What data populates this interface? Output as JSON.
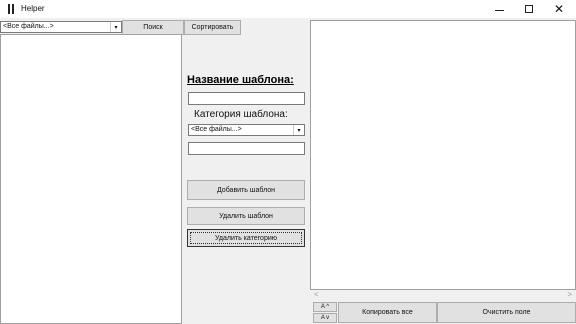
{
  "window": {
    "title": "Helper",
    "minimize_icon": "minimize-icon",
    "maximize_icon": "maximize-icon",
    "close_icon": "close-icon",
    "close_glyph": "✕"
  },
  "left": {
    "filter_combo_value": "<Все файлы...>",
    "combo_arrow": "▾",
    "search_label": "Поиск",
    "sort_label": "Сортировать"
  },
  "form": {
    "template_name_heading": "Название шаблона:",
    "template_category_label": "Категория шаблона:",
    "category_combo_value": "<Все файлы...>",
    "add_button": "Добавить шаблон",
    "delete_button": "Удалить шаблон",
    "delete_category_button": "Удалить категорию"
  },
  "right": {
    "scroll_left": "<",
    "scroll_right": ">",
    "font_up": "A ^",
    "font_down": "A v",
    "copy_all_button": "Копировать все",
    "clear_button": "Очистить поле"
  }
}
